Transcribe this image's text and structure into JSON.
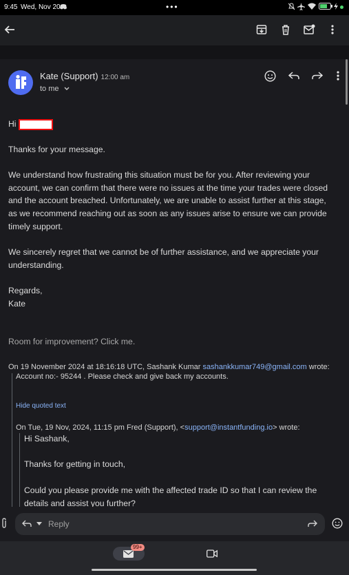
{
  "status_bar": {
    "time": "9:45",
    "date": "Wed, Nov 20",
    "battery": "61"
  },
  "email": {
    "sender_name": "Kate (Support)",
    "sent_time": "12:00 am",
    "recipient": "to me",
    "greeting": "Hi",
    "paragraphs": [
      "Thanks for your message.",
      "We understand how frustrating this situation must be for you. After reviewing your account, we can confirm that there were no issues at the time your trades were closed and the account breached. Unfortunately, we are unable to assist further at this stage, as we recommend reaching out as soon as any issues arise to ensure we can provide timely support.",
      "We sincerely regret that we cannot be of further assistance, and we appreciate your understanding."
    ],
    "sign_off": "Regards,",
    "signature_name": "Kate",
    "feedback_link": "Room for improvement? Click me."
  },
  "quoted": {
    "header_prefix": "On 19 November 2024 at 18:16:18 UTC, Sashank Kumar ",
    "header_email": "sashankkumar749@gmail.com",
    "header_suffix": " wrote:",
    "body": "Account no:- 95244 . Please check and give back my accounts.",
    "hide_label": "Hide quoted text",
    "nested": {
      "header_prefix": "On Tue, 19 Nov, 2024, 11:15 pm Fred (Support), <",
      "header_email": "support@instantfunding.io",
      "header_suffix": "> wrote:",
      "greeting": "Hi Sashank,",
      "line1": "Thanks for getting in touch,",
      "line2": "Could you please provide me with the affected trade ID so that I can review the details and assist you further?"
    }
  },
  "reply_bar": {
    "reply_label": "Reply"
  },
  "bottom_nav": {
    "mail_badge": "99+"
  },
  "colors": {
    "accent_link": "#8ab4f8",
    "avatar": "#4f6cf0",
    "badge": "#f28b82"
  }
}
